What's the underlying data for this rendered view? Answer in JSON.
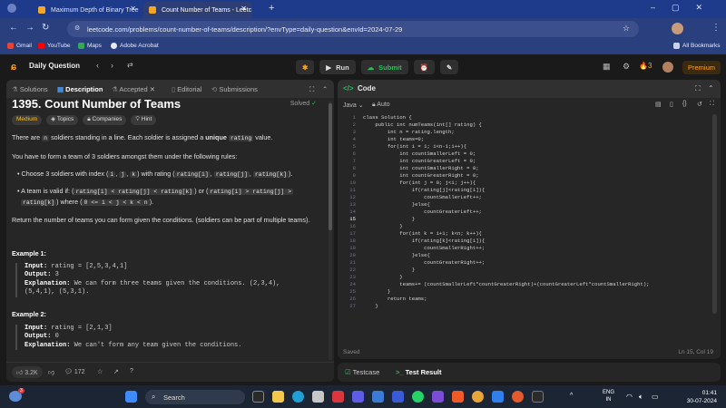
{
  "browser": {
    "tabs": [
      {
        "title": "Maximum Depth of Binary Tree",
        "active": false
      },
      {
        "title": "Count Number of Teams - Leetc",
        "active": true
      }
    ],
    "url": "leetcode.com/problems/count-number-of-teams/description/?envType=daily-question&envId=2024-07-29",
    "bookmarks": [
      "Gmail",
      "YouTube",
      "Maps",
      "Adobe Acrobat"
    ],
    "all_bookmarks": "All Bookmarks"
  },
  "header": {
    "daily_question": "Daily Question",
    "run": "Run",
    "submit": "Submit",
    "streak": "3",
    "premium": "Premium"
  },
  "left": {
    "tabs": [
      "Solutions",
      "Description",
      "Accepted",
      "Editorial",
      "Submissions"
    ],
    "title": "1395. Count Number of Teams",
    "solved": "Solved",
    "chips": [
      "Medium",
      "Topics",
      "Companies",
      "Hint"
    ],
    "p1_pre": "There are ",
    "p1_n": "n",
    "p1_mid": " soldiers standing in a line. Each soldier is assigned a ",
    "p1_unique": "unique",
    "p1_rating": "rating",
    "p1_post": " value.",
    "p2": "You have to form a team of 3 soldiers amongst them under the following rules:",
    "b1_pre": "Choose 3 soldiers with index (",
    "b1_i": "i",
    "b1_j": "j",
    "b1_k": "k",
    "b1_mid": ") with rating (",
    "b1_ri": "rating[i]",
    "b1_rj": "rating[j]",
    "b1_rk": "rating[k]",
    "b1_post": ").",
    "b2_pre": "A team is valid if: (",
    "b2_c1": "rating[i] < rating[j] < rating[k]",
    "b2_or": ") or (",
    "b2_c2a": "rating[i] > rating[j] >",
    "b2_c2b": "rating[k]",
    "b2_where": ") where (",
    "b2_cond": "0 <= i < j < k < n",
    "b2_end": ").",
    "p3": "Return the number of teams you can form given the conditions. (soldiers can be part of multiple teams).",
    "ex1_title": "Example 1:",
    "ex1_input_label": "Input:",
    "ex1_input": " rating = [2,5,3,4,1]",
    "ex1_output_label": "Output:",
    "ex1_output": " 3",
    "ex1_expl_label": "Explanation:",
    "ex1_expl1": " We can form three teams given the conditions. (2,3,4),",
    "ex1_expl2": "(5,4,1), (5,3,1).",
    "ex2_title": "Example 2:",
    "ex2_input_label": "Input:",
    "ex2_input": " rating = [2,1,3]",
    "ex2_output_label": "Output:",
    "ex2_output": " 0",
    "ex2_expl_label": "Explanation:",
    "ex2_expl": " We can't form any team given the conditions.",
    "likes": "3.2K",
    "comments": "172"
  },
  "editor": {
    "title": "Code",
    "language": "Java",
    "mode": "Auto",
    "lines": [
      "class Solution {",
      "    public int numTeams(int[] rating) {",
      "        int n = rating.length;",
      "        int teams=0;",
      "        for(int i = 1; i<n-1;i++){",
      "            int countSmallerLeft = 0;",
      "            int countGreaterLeft = 0;",
      "            int countSmallerRight = 0;",
      "            int countGreaterRight = 0;",
      "            for(int j = 0; j<i; j++){",
      "                if(rating[j]<rating[i]){",
      "                    countSmallerLeft++;",
      "                }else{",
      "                    countGreaterLeft++;",
      "                }",
      "            }",
      "            for(int k = i+1; k<n; k++){",
      "                if(rating[k]<rating[i]){",
      "                    countSmallerRight++;",
      "                }else{",
      "                    countGreaterRight++;",
      "                }",
      "            }",
      "            teams+= (countSmallerLeft*countGreaterRight)+(countGreaterLeft*countSmallerRight);",
      "        }",
      "        return teams;",
      "    }"
    ],
    "saved": "Saved",
    "cursor": "Ln 15, Col 19"
  },
  "bottom": {
    "testcase": "Testcase",
    "result": "Test Result"
  },
  "taskbar": {
    "search": "Search",
    "lang": "ENG",
    "region": "IN",
    "time": "01:41",
    "date": "30-07-2024",
    "badge": "3"
  }
}
